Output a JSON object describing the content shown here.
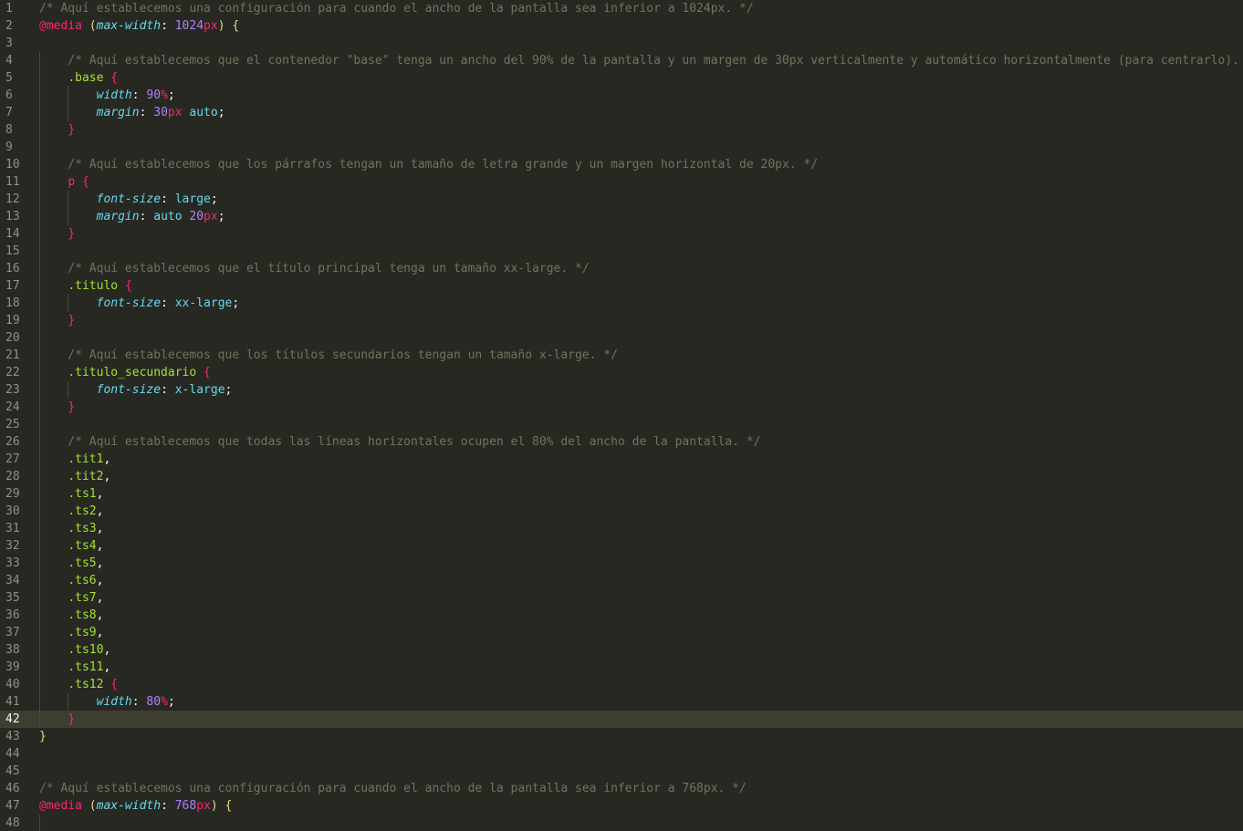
{
  "editor": {
    "current_line": 42,
    "lines": [
      {
        "n": "1",
        "guides": 0,
        "tokens": [
          {
            "t": "/* Aquí establecemos una configuración para cuando el ancho de la pantalla sea inferior a 1024px. */",
            "c": "comment"
          }
        ]
      },
      {
        "n": "2",
        "guides": 0,
        "tokens": [
          {
            "t": "@media",
            "c": "atrule"
          },
          {
            "t": " ",
            "c": "punct"
          },
          {
            "t": "(",
            "c": "brace-y"
          },
          {
            "t": "max-width",
            "c": "prop"
          },
          {
            "t": ": ",
            "c": "punct"
          },
          {
            "t": "1024",
            "c": "num"
          },
          {
            "t": "px",
            "c": "unit"
          },
          {
            "t": ")",
            "c": "brace-y"
          },
          {
            "t": " ",
            "c": "punct"
          },
          {
            "t": "{",
            "c": "brace-y"
          }
        ]
      },
      {
        "n": "3",
        "guides": 0,
        "tokens": []
      },
      {
        "n": "4",
        "guides": 1,
        "tokens": [
          {
            "t": "    /* Aquí establecemos que el contenedor \"base\" tenga un ancho del 90% de la pantalla y un margen de 30px verticalmente y automático horizontalmente (para centrarlo). */",
            "c": "comment"
          }
        ]
      },
      {
        "n": "5",
        "guides": 1,
        "tokens": [
          {
            "t": "    ",
            "c": "punct"
          },
          {
            "t": ".base",
            "c": "selector"
          },
          {
            "t": " ",
            "c": "punct"
          },
          {
            "t": "{",
            "c": "brace-p"
          }
        ]
      },
      {
        "n": "6",
        "guides": 2,
        "tokens": [
          {
            "t": "        ",
            "c": "punct"
          },
          {
            "t": "width",
            "c": "prop"
          },
          {
            "t": ": ",
            "c": "punct"
          },
          {
            "t": "90",
            "c": "num"
          },
          {
            "t": "%",
            "c": "unit"
          },
          {
            "t": ";",
            "c": "punct"
          }
        ]
      },
      {
        "n": "7",
        "guides": 2,
        "tokens": [
          {
            "t": "        ",
            "c": "punct"
          },
          {
            "t": "margin",
            "c": "prop"
          },
          {
            "t": ": ",
            "c": "punct"
          },
          {
            "t": "30",
            "c": "num"
          },
          {
            "t": "px",
            "c": "unit"
          },
          {
            "t": " ",
            "c": "punct"
          },
          {
            "t": "auto",
            "c": "value"
          },
          {
            "t": ";",
            "c": "punct"
          }
        ]
      },
      {
        "n": "8",
        "guides": 1,
        "tokens": [
          {
            "t": "    ",
            "c": "punct"
          },
          {
            "t": "}",
            "c": "brace-p"
          }
        ]
      },
      {
        "n": "9",
        "guides": 1,
        "tokens": []
      },
      {
        "n": "10",
        "guides": 1,
        "tokens": [
          {
            "t": "    /* Aquí establecemos que los párrafos tengan un tamaño de letra grande y un margen horizontal de 20px. */",
            "c": "comment"
          }
        ]
      },
      {
        "n": "11",
        "guides": 1,
        "tokens": [
          {
            "t": "    ",
            "c": "punct"
          },
          {
            "t": "p",
            "c": "tag"
          },
          {
            "t": " ",
            "c": "punct"
          },
          {
            "t": "{",
            "c": "brace-p"
          }
        ]
      },
      {
        "n": "12",
        "guides": 2,
        "tokens": [
          {
            "t": "        ",
            "c": "punct"
          },
          {
            "t": "font-size",
            "c": "prop"
          },
          {
            "t": ": ",
            "c": "punct"
          },
          {
            "t": "large",
            "c": "value"
          },
          {
            "t": ";",
            "c": "punct"
          }
        ]
      },
      {
        "n": "13",
        "guides": 2,
        "tokens": [
          {
            "t": "        ",
            "c": "punct"
          },
          {
            "t": "margin",
            "c": "prop"
          },
          {
            "t": ": ",
            "c": "punct"
          },
          {
            "t": "auto",
            "c": "value"
          },
          {
            "t": " ",
            "c": "punct"
          },
          {
            "t": "20",
            "c": "num"
          },
          {
            "t": "px",
            "c": "unit"
          },
          {
            "t": ";",
            "c": "punct"
          }
        ]
      },
      {
        "n": "14",
        "guides": 1,
        "tokens": [
          {
            "t": "    ",
            "c": "punct"
          },
          {
            "t": "}",
            "c": "brace-p"
          }
        ]
      },
      {
        "n": "15",
        "guides": 1,
        "tokens": []
      },
      {
        "n": "16",
        "guides": 1,
        "tokens": [
          {
            "t": "    /* Aquí establecemos que el título principal tenga un tamaño xx-large. */",
            "c": "comment"
          }
        ]
      },
      {
        "n": "17",
        "guides": 1,
        "tokens": [
          {
            "t": "    ",
            "c": "punct"
          },
          {
            "t": ".titulo",
            "c": "selector"
          },
          {
            "t": " ",
            "c": "punct"
          },
          {
            "t": "{",
            "c": "brace-p"
          }
        ]
      },
      {
        "n": "18",
        "guides": 2,
        "tokens": [
          {
            "t": "        ",
            "c": "punct"
          },
          {
            "t": "font-size",
            "c": "prop"
          },
          {
            "t": ": ",
            "c": "punct"
          },
          {
            "t": "xx-large",
            "c": "value"
          },
          {
            "t": ";",
            "c": "punct"
          }
        ]
      },
      {
        "n": "19",
        "guides": 1,
        "tokens": [
          {
            "t": "    ",
            "c": "punct"
          },
          {
            "t": "}",
            "c": "brace-p"
          }
        ]
      },
      {
        "n": "20",
        "guides": 1,
        "tokens": []
      },
      {
        "n": "21",
        "guides": 1,
        "tokens": [
          {
            "t": "    /* Aquí establecemos que los títulos secundarios tengan un tamaño x-large. */",
            "c": "comment"
          }
        ]
      },
      {
        "n": "22",
        "guides": 1,
        "tokens": [
          {
            "t": "    ",
            "c": "punct"
          },
          {
            "t": ".titulo_secundario",
            "c": "selector"
          },
          {
            "t": " ",
            "c": "punct"
          },
          {
            "t": "{",
            "c": "brace-p"
          }
        ]
      },
      {
        "n": "23",
        "guides": 2,
        "tokens": [
          {
            "t": "        ",
            "c": "punct"
          },
          {
            "t": "font-size",
            "c": "prop"
          },
          {
            "t": ": ",
            "c": "punct"
          },
          {
            "t": "x-large",
            "c": "value"
          },
          {
            "t": ";",
            "c": "punct"
          }
        ]
      },
      {
        "n": "24",
        "guides": 1,
        "tokens": [
          {
            "t": "    ",
            "c": "punct"
          },
          {
            "t": "}",
            "c": "brace-p"
          }
        ]
      },
      {
        "n": "25",
        "guides": 1,
        "tokens": []
      },
      {
        "n": "26",
        "guides": 1,
        "tokens": [
          {
            "t": "    /* Aquí establecemos que todas las líneas horizontales ocupen el 80% del ancho de la pantalla. */",
            "c": "comment"
          }
        ]
      },
      {
        "n": "27",
        "guides": 1,
        "tokens": [
          {
            "t": "    ",
            "c": "punct"
          },
          {
            "t": ".tit1",
            "c": "selector"
          },
          {
            "t": ",",
            "c": "punct"
          }
        ]
      },
      {
        "n": "28",
        "guides": 1,
        "tokens": [
          {
            "t": "    ",
            "c": "punct"
          },
          {
            "t": ".tit2",
            "c": "selector"
          },
          {
            "t": ",",
            "c": "punct"
          }
        ]
      },
      {
        "n": "29",
        "guides": 1,
        "tokens": [
          {
            "t": "    ",
            "c": "punct"
          },
          {
            "t": ".ts1",
            "c": "selector"
          },
          {
            "t": ",",
            "c": "punct"
          }
        ]
      },
      {
        "n": "30",
        "guides": 1,
        "tokens": [
          {
            "t": "    ",
            "c": "punct"
          },
          {
            "t": ".ts2",
            "c": "selector"
          },
          {
            "t": ",",
            "c": "punct"
          }
        ]
      },
      {
        "n": "31",
        "guides": 1,
        "tokens": [
          {
            "t": "    ",
            "c": "punct"
          },
          {
            "t": ".ts3",
            "c": "selector"
          },
          {
            "t": ",",
            "c": "punct"
          }
        ]
      },
      {
        "n": "32",
        "guides": 1,
        "tokens": [
          {
            "t": "    ",
            "c": "punct"
          },
          {
            "t": ".ts4",
            "c": "selector"
          },
          {
            "t": ",",
            "c": "punct"
          }
        ]
      },
      {
        "n": "33",
        "guides": 1,
        "tokens": [
          {
            "t": "    ",
            "c": "punct"
          },
          {
            "t": ".ts5",
            "c": "selector"
          },
          {
            "t": ",",
            "c": "punct"
          }
        ]
      },
      {
        "n": "34",
        "guides": 1,
        "tokens": [
          {
            "t": "    ",
            "c": "punct"
          },
          {
            "t": ".ts6",
            "c": "selector"
          },
          {
            "t": ",",
            "c": "punct"
          }
        ]
      },
      {
        "n": "35",
        "guides": 1,
        "tokens": [
          {
            "t": "    ",
            "c": "punct"
          },
          {
            "t": ".ts7",
            "c": "selector"
          },
          {
            "t": ",",
            "c": "punct"
          }
        ]
      },
      {
        "n": "36",
        "guides": 1,
        "tokens": [
          {
            "t": "    ",
            "c": "punct"
          },
          {
            "t": ".ts8",
            "c": "selector"
          },
          {
            "t": ",",
            "c": "punct"
          }
        ]
      },
      {
        "n": "37",
        "guides": 1,
        "tokens": [
          {
            "t": "    ",
            "c": "punct"
          },
          {
            "t": ".ts9",
            "c": "selector"
          },
          {
            "t": ",",
            "c": "punct"
          }
        ]
      },
      {
        "n": "38",
        "guides": 1,
        "tokens": [
          {
            "t": "    ",
            "c": "punct"
          },
          {
            "t": ".ts10",
            "c": "selector"
          },
          {
            "t": ",",
            "c": "punct"
          }
        ]
      },
      {
        "n": "39",
        "guides": 1,
        "tokens": [
          {
            "t": "    ",
            "c": "punct"
          },
          {
            "t": ".ts11",
            "c": "selector"
          },
          {
            "t": ",",
            "c": "punct"
          }
        ]
      },
      {
        "n": "40",
        "guides": 1,
        "tokens": [
          {
            "t": "    ",
            "c": "punct"
          },
          {
            "t": ".ts12",
            "c": "selector"
          },
          {
            "t": " ",
            "c": "punct"
          },
          {
            "t": "{",
            "c": "brace-p"
          }
        ]
      },
      {
        "n": "41",
        "guides": 2,
        "tokens": [
          {
            "t": "        ",
            "c": "punct"
          },
          {
            "t": "width",
            "c": "prop"
          },
          {
            "t": ": ",
            "c": "punct"
          },
          {
            "t": "80",
            "c": "num"
          },
          {
            "t": "%",
            "c": "unit"
          },
          {
            "t": ";",
            "c": "punct"
          }
        ]
      },
      {
        "n": "42",
        "guides": 1,
        "tokens": [
          {
            "t": "    ",
            "c": "punct"
          },
          {
            "t": "}",
            "c": "brace-p"
          }
        ]
      },
      {
        "n": "43",
        "guides": 0,
        "tokens": [
          {
            "t": "}",
            "c": "brace-y"
          }
        ]
      },
      {
        "n": "44",
        "guides": 0,
        "tokens": []
      },
      {
        "n": "45",
        "guides": 0,
        "tokens": []
      },
      {
        "n": "46",
        "guides": 0,
        "tokens": [
          {
            "t": "/* Aquí establecemos una configuración para cuando el ancho de la pantalla sea inferior a 768px. */",
            "c": "comment"
          }
        ]
      },
      {
        "n": "47",
        "guides": 0,
        "tokens": [
          {
            "t": "@media",
            "c": "atrule"
          },
          {
            "t": " ",
            "c": "punct"
          },
          {
            "t": "(",
            "c": "brace-y"
          },
          {
            "t": "max-width",
            "c": "prop"
          },
          {
            "t": ": ",
            "c": "punct"
          },
          {
            "t": "768",
            "c": "num"
          },
          {
            "t": "px",
            "c": "unit"
          },
          {
            "t": ")",
            "c": "brace-y"
          },
          {
            "t": " ",
            "c": "punct"
          },
          {
            "t": "{",
            "c": "brace-y"
          }
        ]
      },
      {
        "n": "48",
        "guides": 1,
        "tokens": []
      }
    ]
  }
}
